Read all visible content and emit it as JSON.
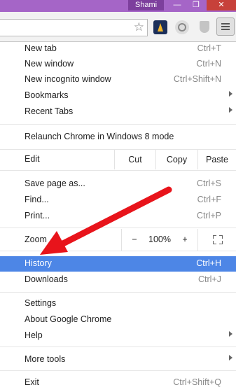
{
  "titlebar": {
    "user": "Shami",
    "minimize": "—",
    "maximize": "❐",
    "close": "✕"
  },
  "menu": {
    "items_top": [
      {
        "label": "New tab",
        "shortcut": "Ctrl+T"
      },
      {
        "label": "New window",
        "shortcut": "Ctrl+N"
      },
      {
        "label": "New incognito window",
        "shortcut": "Ctrl+Shift+N"
      },
      {
        "label": "Bookmarks",
        "shortcut": ""
      },
      {
        "label": "Recent Tabs",
        "shortcut": ""
      }
    ],
    "relaunch": "Relaunch Chrome in Windows 8 mode",
    "edit": {
      "label": "Edit",
      "cut": "Cut",
      "copy": "Copy",
      "paste": "Paste"
    },
    "items_mid": [
      {
        "label": "Save page as...",
        "shortcut": "Ctrl+S"
      },
      {
        "label": "Find...",
        "shortcut": "Ctrl+F"
      },
      {
        "label": "Print...",
        "shortcut": "Ctrl+P"
      }
    ],
    "zoom": {
      "label": "Zoom",
      "minus": "−",
      "value": "100%",
      "plus": "+"
    },
    "items_hist": [
      {
        "label": "History",
        "shortcut": "Ctrl+H"
      },
      {
        "label": "Downloads",
        "shortcut": "Ctrl+J"
      }
    ],
    "items_settings": [
      {
        "label": "Settings"
      },
      {
        "label": "About Google Chrome"
      },
      {
        "label": "Help"
      }
    ],
    "more_tools": "More tools",
    "exit": {
      "label": "Exit",
      "shortcut": "Ctrl+Shift+Q"
    }
  },
  "colors": {
    "highlight": "#4d86e6",
    "annotation_arrow": "#e8141b",
    "titlebar": "#a565c7"
  }
}
